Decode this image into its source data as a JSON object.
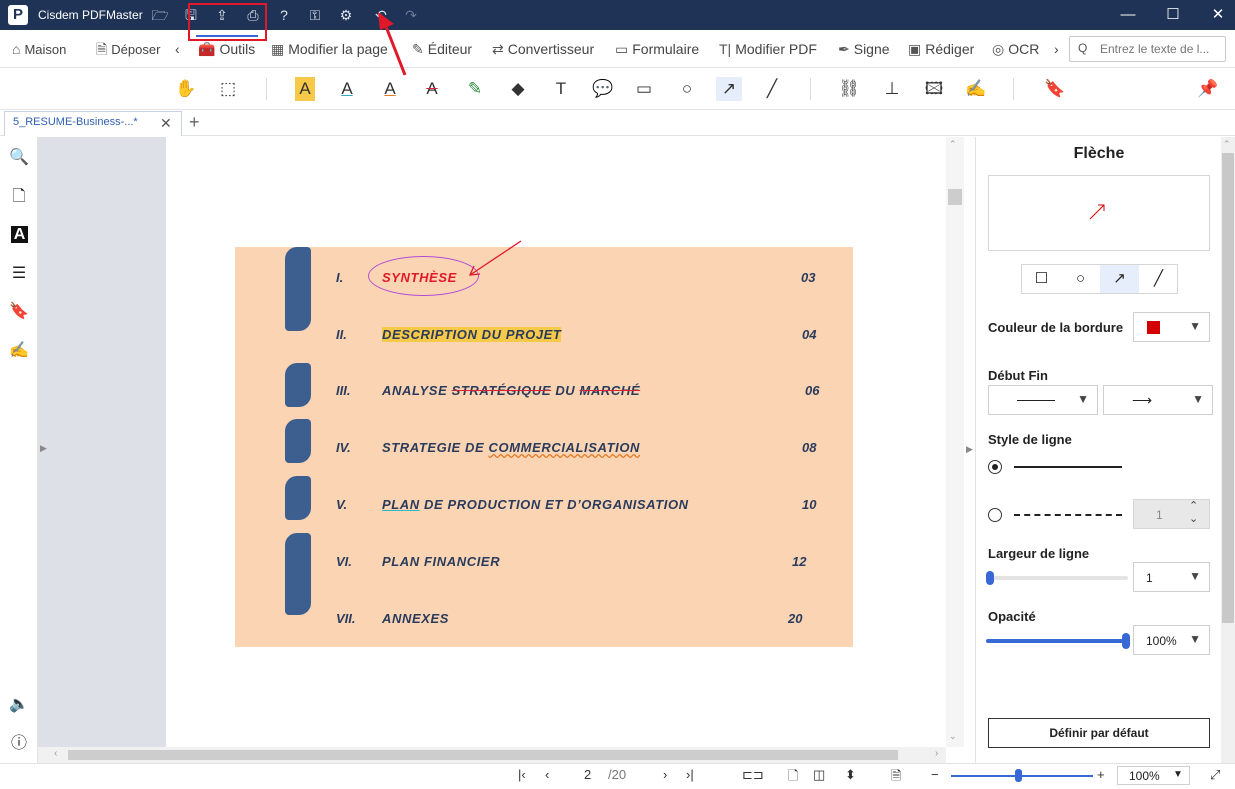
{
  "app": {
    "title": "Cisdem PDFMaster",
    "logo": "P"
  },
  "titlebar": {
    "minimize": "—",
    "maximize": "☐",
    "close": "✕"
  },
  "ribbon": {
    "maison": "Maison",
    "deposer": "Déposer",
    "outils": "Outils",
    "modifier_page": "Modifier la page",
    "editeur": "Éditeur",
    "convertisseur": "Convertisseur",
    "formulaire": "Formulaire",
    "modifier_pdf": "Modifier PDF",
    "signe": "Signe",
    "rediger": "Rédiger",
    "ocr": "OCR",
    "search_placeholder": "Entrez le texte de l..."
  },
  "tab": {
    "name": "5_RESUME-Business-...*"
  },
  "toc": {
    "rows": [
      {
        "num": "I.",
        "title": "SYNTHÈSE",
        "page": "03"
      },
      {
        "num": "II.",
        "title": "DESCRIPTION DU PROJET",
        "page": "04"
      },
      {
        "num": "III.",
        "title_a": "ANALYSE ",
        "title_b": "STRATÉGIQUE",
        "title_c": " DU ",
        "title_d": "MARCHÉ",
        "page": "06"
      },
      {
        "num": "IV.",
        "title_a": "STRATEGIE DE ",
        "title_b": "COMMERCIALISATION",
        "page": "08"
      },
      {
        "num": "V.",
        "title_a": "PLAN",
        "title_b": " DE PRODUCTION ET D’ORGANISATION",
        "page": "10"
      },
      {
        "num": "VI.",
        "title": "PLAN FINANCIER",
        "page": "12"
      },
      {
        "num": "VII.",
        "title": "ANNEXES",
        "page": "20"
      }
    ]
  },
  "panel": {
    "title": "Flèche",
    "border_color_label": "Couleur de la bordure",
    "border_color": "#d40000",
    "start_end_label": "Début Fin",
    "line_style_label": "Style de ligne",
    "dash_value": "1",
    "line_width_label": "Largeur de ligne",
    "line_width_value": "1",
    "opacity_label": "Opacité",
    "opacity_value": "100%",
    "default_button": "Définir par défaut"
  },
  "status": {
    "page_current": "2",
    "page_total": "/20",
    "zoom": "100%"
  },
  "colors": {
    "titlebar": "#1f3356",
    "accent": "#3867d6",
    "highlight_red": "#e0182a"
  }
}
